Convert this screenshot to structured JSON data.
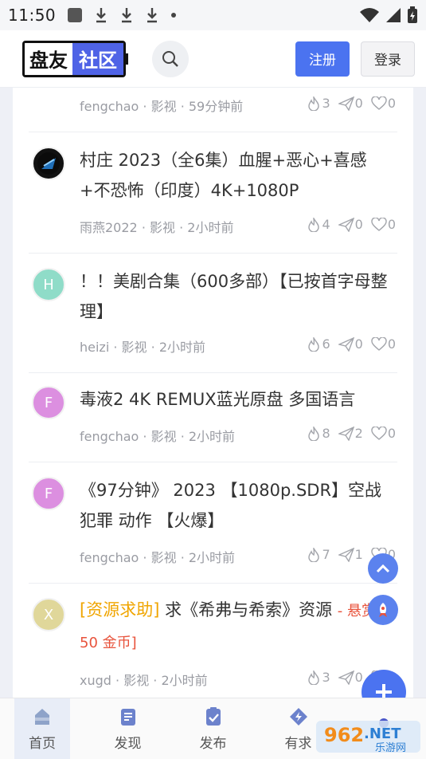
{
  "status_bar": {
    "time": "11:50"
  },
  "header": {
    "logo_left": "盘友",
    "logo_right": "社区",
    "register_label": "注册",
    "login_label": "登录"
  },
  "posts": [
    {
      "title": "",
      "author": "fengchao",
      "category": "影视",
      "time": "59分钟前",
      "likes": "3",
      "shares": "0",
      "favs": "0",
      "avatar": ""
    },
    {
      "title": "村庄 2023（全6集）血腥+恶心+喜感+不恐怖（印度）4K+1080P",
      "author": "雨燕2022",
      "category": "影视",
      "time": "2小时前",
      "likes": "4",
      "shares": "0",
      "favs": "0",
      "avatar": ""
    },
    {
      "title": "！！美剧合集（600多部）【已按首字母整理】",
      "author": "heizi",
      "category": "影视",
      "time": "2小时前",
      "likes": "6",
      "shares": "0",
      "favs": "0",
      "avatar": "H"
    },
    {
      "title": "毒液2 4K REMUX蓝光原盘 多国语言",
      "author": "fengchao",
      "category": "影视",
      "time": "2小时前",
      "likes": "8",
      "shares": "2",
      "favs": "0",
      "avatar": "F"
    },
    {
      "title": "《97分钟》 2023 【1080p.SDR】空战 犯罪 动作 【火爆】",
      "author": "fengchao",
      "category": "影视",
      "time": "2小时前",
      "likes": "7",
      "shares": "1",
      "favs": "0",
      "avatar": "F"
    },
    {
      "tag": "[资源求助]",
      "title": " 求《希弗与希索》资源 ",
      "reward": "- 悬赏 50 金币]",
      "author": "xugd",
      "category": "影视",
      "time": "2小时前",
      "likes": "3",
      "shares": "0",
      "favs": "0",
      "avatar": "X"
    }
  ],
  "nav": [
    {
      "label": "首页",
      "icon": "home-icon"
    },
    {
      "label": "发现",
      "icon": "discover-icon"
    },
    {
      "label": "发布",
      "icon": "publish-icon"
    },
    {
      "label": "有求",
      "icon": "request-icon"
    },
    {
      "label": "",
      "icon": "profile-icon"
    }
  ],
  "watermark": {
    "text1": "962",
    "text2": ".NET",
    "text3": "乐游网"
  },
  "colors": {
    "accent": "#4b73f0",
    "tag": "#f0a500",
    "reward": "#e8533c"
  }
}
